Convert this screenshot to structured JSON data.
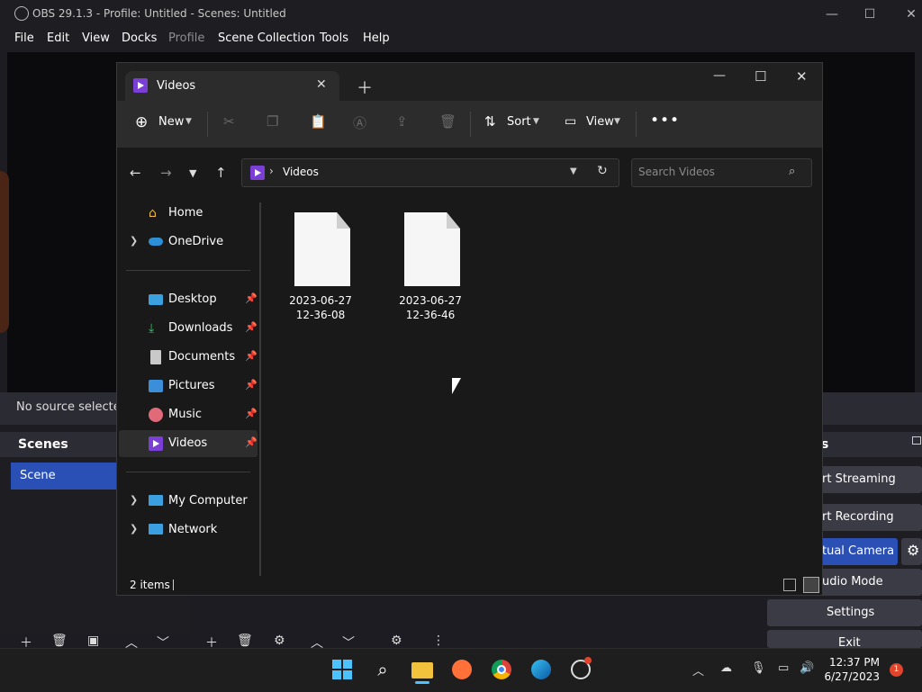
{
  "obs": {
    "title": "OBS 29.1.3 - Profile: Untitled - Scenes: Untitled",
    "menu": [
      "File",
      "Edit",
      "View",
      "Docks",
      "Profile",
      "Scene Collection",
      "Tools",
      "Help"
    ],
    "no_source": "No source selected",
    "scenes_title": "Scenes",
    "scene_item": "Scene",
    "controls_partial": "s",
    "buttons": {
      "streaming": "rt Streaming",
      "recording": "rt Recording",
      "virtual_camera": "tual Camera",
      "studio_mode": "udio Mode",
      "settings": "Settings",
      "exit": "Exit"
    }
  },
  "explorer": {
    "tab_title": "Videos",
    "toolbar": {
      "new": "New",
      "sort": "Sort",
      "view": "View"
    },
    "breadcrumb": "Videos",
    "search_placeholder": "Search Videos",
    "sidebar": {
      "home": "Home",
      "onedrive": "OneDrive",
      "desktop": "Desktop",
      "downloads": "Downloads",
      "documents": "Documents",
      "pictures": "Pictures",
      "music": "Music",
      "videos": "Videos",
      "my_computer": "My Computer",
      "network": "Network"
    },
    "files": [
      {
        "line1": "2023-06-27",
        "line2": "12-36-08"
      },
      {
        "line1": "2023-06-27",
        "line2": "12-36-46"
      }
    ],
    "status": "2 items"
  },
  "taskbar": {
    "time": "12:37 PM",
    "date": "6/27/2023",
    "notification_count": "1"
  },
  "colors": {
    "accent": "#2a4fb5",
    "folder_purple": "#7b3fd6",
    "notification": "#e0452b"
  }
}
